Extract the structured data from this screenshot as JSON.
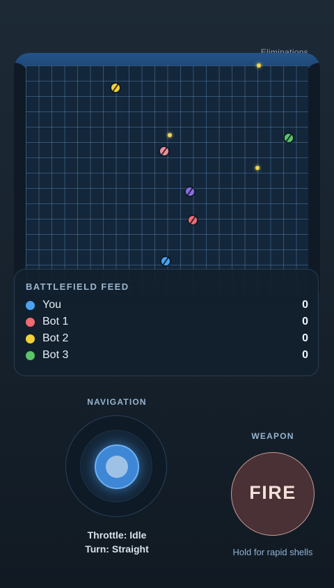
{
  "hud": {
    "eliminations_label": "Eliminations"
  },
  "arena": {
    "tanks": [
      {
        "name": "tank-you",
        "color": "#4aa3f0"
      },
      {
        "name": "tank-bot-1",
        "color": "#f06a72"
      },
      {
        "name": "tank-bot-2",
        "color": "#f2d03a"
      },
      {
        "name": "tank-bot-3",
        "color": "#5cc466"
      },
      {
        "name": "tank-purple",
        "color": "#8e6ce0"
      },
      {
        "name": "tank-pink",
        "color": "#f0909a"
      }
    ]
  },
  "feed": {
    "title": "BATTLEFIELD FEED",
    "players": [
      {
        "name": "You",
        "score": "0",
        "color": "#4aa3f0"
      },
      {
        "name": "Bot 1",
        "score": "0",
        "color": "#f06a72"
      },
      {
        "name": "Bot 2",
        "score": "0",
        "color": "#f2d03a"
      },
      {
        "name": "Bot 3",
        "score": "0",
        "color": "#5cc466"
      }
    ]
  },
  "navigation": {
    "title": "NAVIGATION",
    "throttle": "Throttle: Idle",
    "turn": "Turn: Straight"
  },
  "weapon": {
    "title": "WEAPON",
    "fire_label": "FIRE",
    "hint": "Hold for rapid shells"
  }
}
